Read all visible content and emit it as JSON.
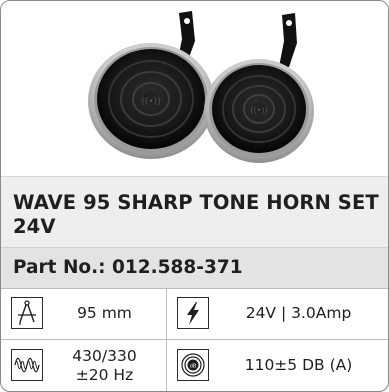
{
  "product": {
    "title": "WAVE 95 SHARP TONE HORN SET 24V",
    "part_no": "Part No.: 012.588-371"
  },
  "specs": [
    {
      "icon": "compass-divider-icon",
      "value": "95 mm"
    },
    {
      "icon": "lightning-bolt-icon",
      "value": "24V | 3.0Amp"
    },
    {
      "icon": "frequency-wave-icon",
      "value_line1": "430/330",
      "value_line2": "±20 Hz"
    },
    {
      "icon": "decibel-sound-icon",
      "value": "110±5 DB (A)"
    }
  ],
  "colors": {
    "title_band": "#eeeeee",
    "partno_band": "#e3e3e3",
    "border": "#bdbdbd",
    "text": "#1f1f1f"
  }
}
